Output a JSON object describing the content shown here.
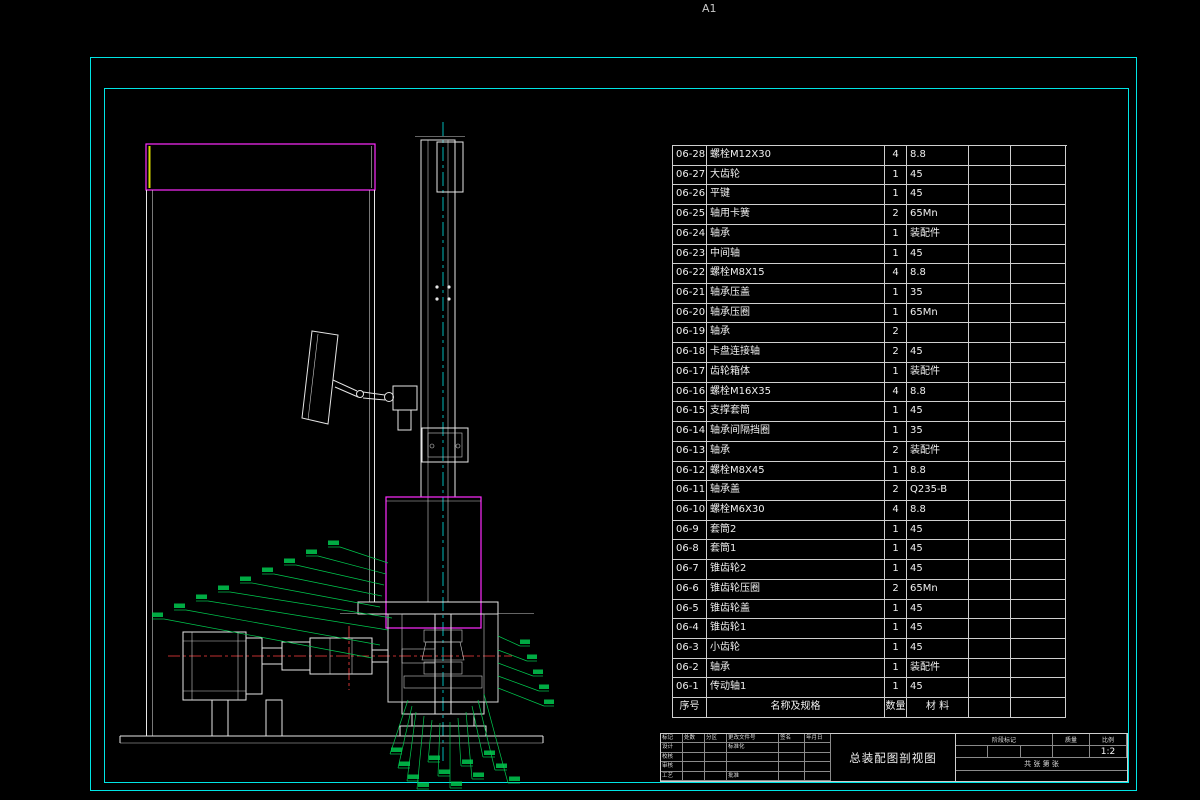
{
  "page": {
    "size_label": "A1"
  },
  "colors": {
    "background": "#000000",
    "frame_cyan": "#00e5e5",
    "outline_white": "#e6e6e6",
    "highlight_magenta": "#ff2bff",
    "hatch_yellow": "#d9d900",
    "leader_green": "#00c94f",
    "centerline_red": "#ff4040"
  },
  "bom": {
    "header": {
      "no": "序号",
      "name": "名称及规格",
      "qty": "数量",
      "material": "材 料"
    },
    "rows": [
      {
        "no": "06-28",
        "name": "螺栓M12X30",
        "qty": "4",
        "material": "8.8"
      },
      {
        "no": "06-27",
        "name": "大齿轮",
        "qty": "1",
        "material": "45"
      },
      {
        "no": "06-26",
        "name": "平键",
        "qty": "1",
        "material": "45"
      },
      {
        "no": "06-25",
        "name": "轴用卡簧",
        "qty": "2",
        "material": "65Mn"
      },
      {
        "no": "06-24",
        "name": "轴承",
        "qty": "1",
        "material": "装配件"
      },
      {
        "no": "06-23",
        "name": "中间轴",
        "qty": "1",
        "material": "45"
      },
      {
        "no": "06-22",
        "name": "螺栓M8X15",
        "qty": "4",
        "material": "8.8"
      },
      {
        "no": "06-21",
        "name": "轴承压盖",
        "qty": "1",
        "material": "35"
      },
      {
        "no": "06-20",
        "name": "轴承压圈",
        "qty": "1",
        "material": "65Mn"
      },
      {
        "no": "06-19",
        "name": "轴承",
        "qty": "2",
        "material": ""
      },
      {
        "no": "06-18",
        "name": "卡盘连接轴",
        "qty": "2",
        "material": "45"
      },
      {
        "no": "06-17",
        "name": "齿轮箱体",
        "qty": "1",
        "material": "装配件"
      },
      {
        "no": "06-16",
        "name": "螺栓M16X35",
        "qty": "4",
        "material": "8.8"
      },
      {
        "no": "06-15",
        "name": "支撑套筒",
        "qty": "1",
        "material": "45"
      },
      {
        "no": "06-14",
        "name": "轴承间隔挡圈",
        "qty": "1",
        "material": "35"
      },
      {
        "no": "06-13",
        "name": "轴承",
        "qty": "2",
        "material": "装配件"
      },
      {
        "no": "06-12",
        "name": "螺栓M8X45",
        "qty": "1",
        "material": "8.8"
      },
      {
        "no": "06-11",
        "name": "轴承盖",
        "qty": "2",
        "material": "Q235-B"
      },
      {
        "no": "06-10",
        "name": "螺栓M6X30",
        "qty": "4",
        "material": "8.8"
      },
      {
        "no": "06-9",
        "name": "套筒2",
        "qty": "1",
        "material": "45"
      },
      {
        "no": "06-8",
        "name": "套筒1",
        "qty": "1",
        "material": "45"
      },
      {
        "no": "06-7",
        "name": "锥齿轮2",
        "qty": "1",
        "material": "45"
      },
      {
        "no": "06-6",
        "name": "锥齿轮压圈",
        "qty": "2",
        "material": "65Mn"
      },
      {
        "no": "06-5",
        "name": "锥齿轮盖",
        "qty": "1",
        "material": "45"
      },
      {
        "no": "06-4",
        "name": "锥齿轮1",
        "qty": "1",
        "material": "45"
      },
      {
        "no": "06-3",
        "name": "小齿轮",
        "qty": "1",
        "material": "45"
      },
      {
        "no": "06-2",
        "name": "轴承",
        "qty": "1",
        "material": "装配件"
      },
      {
        "no": "06-1",
        "name": "传动轴1",
        "qty": "1",
        "material": "45"
      }
    ]
  },
  "titleblock": {
    "title": "总装配图剖视图",
    "rev_headers": [
      "标记",
      "处数",
      "分区",
      "更改文件号",
      "签名",
      "年月日"
    ],
    "role_design": "设计",
    "role_check": "校核",
    "role_audit": "审核",
    "role_process": "工艺",
    "role_standard": "标准化",
    "role_approve": "批准",
    "stage_label": "阶段标记",
    "mass_label": "质量",
    "scale_label": "比例",
    "scale_value": "1:2",
    "sheet_label": "共 张 第 张"
  }
}
